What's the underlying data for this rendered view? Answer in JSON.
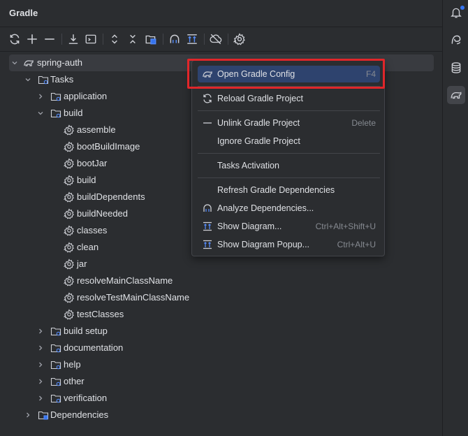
{
  "panel": {
    "title": "Gradle"
  },
  "toolbar": {
    "icons": [
      "refresh-icon",
      "add-icon",
      "remove-icon",
      "download-icon",
      "execute-task-icon",
      "expand-all-icon",
      "collapse-all-icon",
      "group-modules-icon",
      "analyze-icon",
      "diagram-icon",
      "offline-icon",
      "settings-icon"
    ]
  },
  "tree": {
    "root": "spring-auth",
    "tasks": "Tasks",
    "groups_before": [
      "application"
    ],
    "build_group": "build",
    "build_tasks": [
      "assemble",
      "bootBuildImage",
      "bootJar",
      "build",
      "buildDependents",
      "buildNeeded",
      "classes",
      "clean",
      "jar",
      "resolveMainClassName",
      "resolveTestMainClassName",
      "testClasses"
    ],
    "groups_after": [
      "build setup",
      "documentation",
      "help",
      "other",
      "verification"
    ],
    "dependencies": "Dependencies"
  },
  "menu": {
    "items": [
      {
        "label": "Open Gradle Config",
        "shortcut": "F4",
        "icon": "gradle-icon",
        "active": true
      },
      {
        "label": "Reload Gradle Project",
        "shortcut": "",
        "icon": "reload-icon"
      },
      {
        "label": "Unlink Gradle Project",
        "shortcut": "Delete",
        "icon": "minus-icon"
      },
      {
        "label": "Ignore Gradle Project",
        "shortcut": "",
        "icon": ""
      },
      {
        "label": "Tasks Activation",
        "shortcut": "",
        "icon": ""
      },
      {
        "label": "Refresh Gradle Dependencies",
        "shortcut": "",
        "icon": ""
      },
      {
        "label": "Analyze Dependencies...",
        "shortcut": "",
        "icon": "analyze-icon"
      },
      {
        "label": "Show Diagram...",
        "shortcut": "Ctrl+Alt+Shift+U",
        "icon": "diagram-icon"
      },
      {
        "label": "Show Diagram Popup...",
        "shortcut": "Ctrl+Alt+U",
        "icon": "diagram-icon"
      }
    ]
  },
  "rightbar": {
    "icons": [
      "notifications-icon",
      "ai-assistant-icon",
      "database-icon",
      "gradle-icon"
    ]
  },
  "colors": {
    "accent": "#3574f0",
    "selection": "#2e436e",
    "highlight_box": "#e0262a"
  }
}
